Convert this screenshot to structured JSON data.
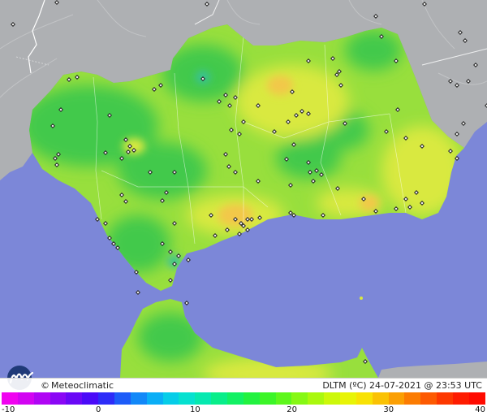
{
  "map": {
    "sea_color": "#7c87d8",
    "land_outside_color": "#aeb0b3",
    "region_colors": {
      "cool": "#43c94c",
      "mid": "#98df3d",
      "warm": "#d9e93f",
      "hot": "#f2c848"
    }
  },
  "footer": {
    "logo_icon": "meteoclimatic-logo-icon",
    "copyright_symbol": "©",
    "brand": "Meteoclimatic",
    "caption": "DLTM (ºC)  24-07-2021 @ 23:53 UTC"
  },
  "scale": {
    "min": -10,
    "max": 40,
    "ticks": [
      "-10",
      "0",
      "10",
      "20",
      "30",
      "40"
    ],
    "colors": [
      "#f003f0",
      "#d204f2",
      "#b005f4",
      "#8a07f5",
      "#6a08f6",
      "#4a0af8",
      "#2d2cf8",
      "#1d5cf8",
      "#1288f8",
      "#0aaef6",
      "#06cde8",
      "#06e1d0",
      "#06e9b0",
      "#08ee8a",
      "#12f164",
      "#22f240",
      "#3cf528",
      "#5ef71c",
      "#86f814",
      "#aaf80e",
      "#ccf80a",
      "#e8f407",
      "#f8e205",
      "#fac204",
      "#fb9f03",
      "#fc7c02",
      "#fd5a01",
      "#fd3800",
      "#fe1c00",
      "#ff0a00"
    ]
  }
}
